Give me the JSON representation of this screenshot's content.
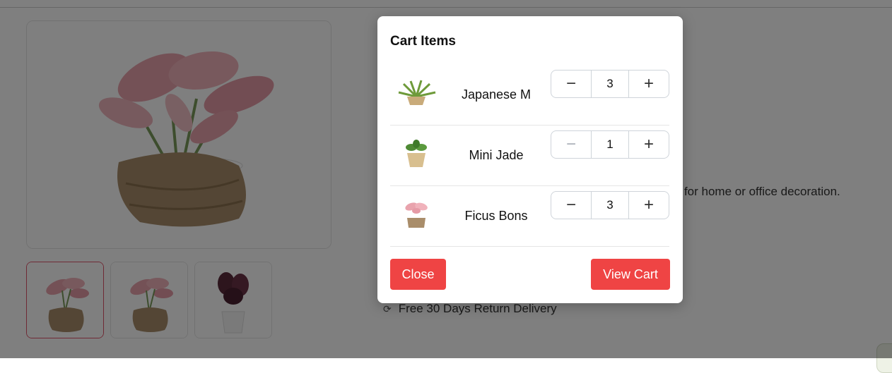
{
  "page": {
    "description_fragment": "ct for home or office decoration.",
    "return_policy": "Free 30 Days Return Delivery"
  },
  "modal": {
    "title": "Cart Items",
    "items": [
      {
        "name": "Japanese M",
        "quantity": "3",
        "image": "fern-plant-in-jute-pot"
      },
      {
        "name": "Mini Jade",
        "quantity": "1",
        "image": "jade-plant-in-basket"
      },
      {
        "name": "Ficus Bons",
        "quantity": "3",
        "image": "pink-aglaonema-in-jute-pot"
      }
    ],
    "minus_symbol": "−",
    "plus_symbol": "+",
    "close_label": "Close",
    "view_cart_label": "View Cart"
  },
  "colors": {
    "accent_button": "#ef4444",
    "active_thumb_border": "#e0546a",
    "overlay": "rgba(0,0,0,0.5)"
  },
  "icons": {
    "return": "refresh-icon"
  }
}
